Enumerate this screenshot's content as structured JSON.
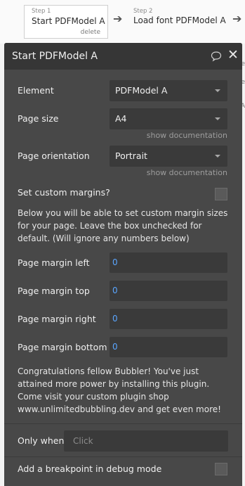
{
  "workflow": {
    "step1": {
      "number": "Step 1",
      "title": "Start PDFModel A",
      "delete_label": "delete"
    },
    "step2": {
      "number": "Step 2",
      "title": "Load font PDFModel A"
    },
    "edge_fragments": [
      "e",
      "e",
      "A"
    ]
  },
  "panel": {
    "title": "Start PDFModel A",
    "fields": {
      "element": {
        "label": "Element",
        "value": "PDFModel A"
      },
      "page_size": {
        "label": "Page size",
        "value": "A4",
        "doc_link": "show documentation"
      },
      "page_orientation": {
        "label": "Page orientation",
        "value": "Portrait",
        "doc_link": "show documentation"
      },
      "custom_margins": {
        "label": "Set custom margins?",
        "checked": false
      },
      "margin_help": "Below you will be able to set custom margin sizes for your page. Leave the box unchecked for default. (Will ignore any numbers below)",
      "margin_left": {
        "label": "Page margin left",
        "value": "0"
      },
      "margin_top": {
        "label": "Page margin top",
        "value": "0"
      },
      "margin_right": {
        "label": "Page margin right",
        "value": "0"
      },
      "margin_bottom": {
        "label": "Page margin bottom",
        "value": "0"
      },
      "promo": "Congratulations fellow Bubbler! You've just attained more power by installing this plugin. Come visit your custom plugin shop www.unlimitedbubbling.dev and get even more!"
    },
    "only_when": {
      "label": "Only when",
      "placeholder": "Click"
    },
    "breakpoint": {
      "label": "Add a breakpoint in debug mode",
      "checked": false
    }
  },
  "colors": {
    "panel_bg": "#484848",
    "header_bg": "#363636",
    "input_bg": "#3a3a3a",
    "number_value": "#5aa6ff"
  },
  "icons": [
    "comment-icon",
    "close-icon",
    "arrow-right-icon",
    "chevron-down-icon"
  ]
}
